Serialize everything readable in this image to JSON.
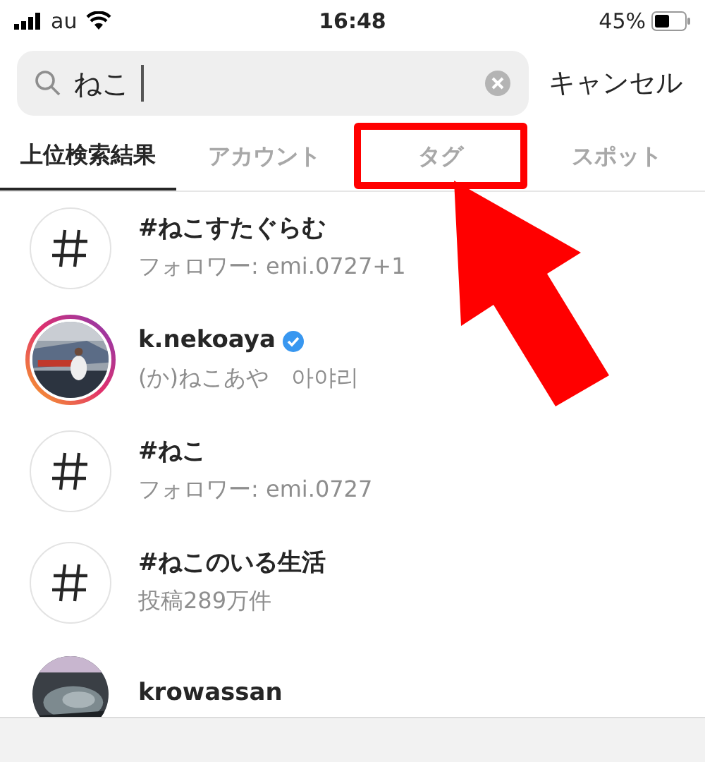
{
  "status_bar": {
    "carrier": "au",
    "time": "16:48",
    "battery": "45%"
  },
  "search": {
    "value": "ねこ",
    "cancel": "キャンセル"
  },
  "tabs": [
    {
      "label": "上位検索結果",
      "selected": true,
      "highlighted": false
    },
    {
      "label": "アカウント",
      "selected": false,
      "highlighted": false
    },
    {
      "label": "タグ",
      "selected": false,
      "highlighted": true
    },
    {
      "label": "スポット",
      "selected": false,
      "highlighted": false
    }
  ],
  "results": [
    {
      "kind": "hashtag",
      "title": "#ねこすたぐらむ",
      "subtitle": "フォロワー: emi.0727+1"
    },
    {
      "kind": "account",
      "title": "k.nekoaya",
      "verified": true,
      "story": true,
      "subtitle": "(か)ねこあや　아야리"
    },
    {
      "kind": "hashtag",
      "title": "#ねこ",
      "subtitle": "フォロワー: emi.0727"
    },
    {
      "kind": "hashtag",
      "title": "#ねこのいる生活",
      "subtitle": "投稿289万件"
    },
    {
      "kind": "account",
      "title": "krowassan",
      "verified": false,
      "story": false
    }
  ]
}
